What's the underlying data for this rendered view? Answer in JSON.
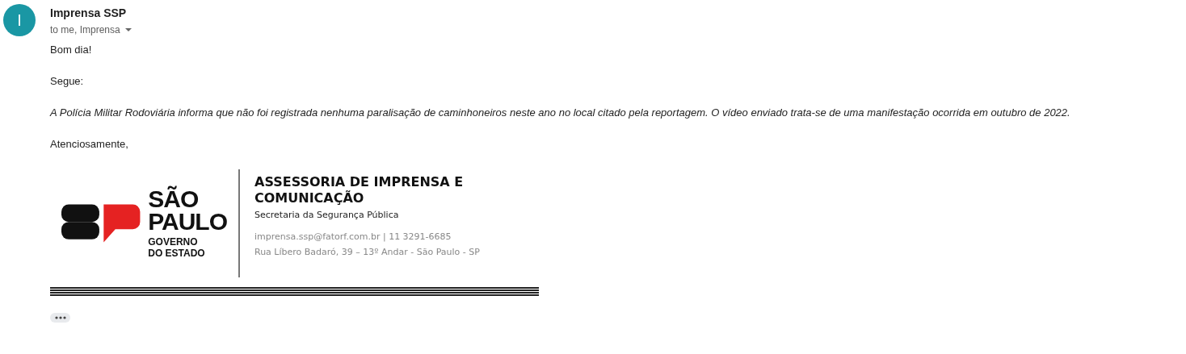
{
  "sender": {
    "avatar_letter": "I",
    "name": "Imprensa SSP",
    "recipients": "to me, Imprensa"
  },
  "body": [
    {
      "kind": "plain",
      "text": "Bom dia!"
    },
    {
      "kind": "plain",
      "text": "Segue:"
    },
    {
      "kind": "italic",
      "text": "A Polícia Militar Rodoviária informa que não foi registrada nenhuma paralisação de caminhoneiros neste ano no local citado pela reportagem. O vídeo enviado trata-se de uma manifestação ocorrida em outubro de 2022."
    },
    {
      "kind": "plain",
      "text": "Atenciosamente,"
    }
  ],
  "signature": {
    "logo_lines": [
      "SÃO",
      "PAULO"
    ],
    "logo_sub": [
      "GOVERNO",
      "DO ESTADO"
    ],
    "title": "ASSESSORIA DE IMPRENSA E COMUNICAÇÃO",
    "department": "Secretaria da Segurança Pública",
    "contact": "imprensa.ssp@fatorf.com.br | 11 3291-6685",
    "address": "Rua Líbero Badaró, 39 – 13º Andar - São Paulo - SP"
  }
}
